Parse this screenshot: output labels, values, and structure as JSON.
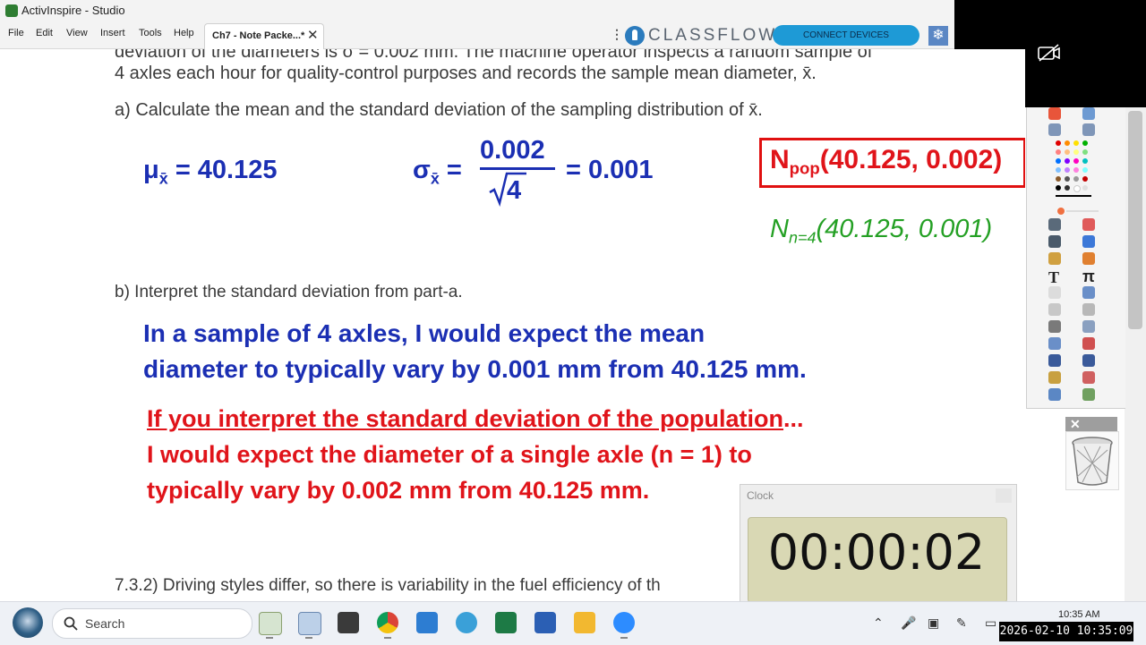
{
  "window": {
    "title": "ActivInspire - Studio"
  },
  "menu": {
    "items": [
      "File",
      "Edit",
      "View",
      "Insert",
      "Tools",
      "Help"
    ]
  },
  "doc_tab": {
    "label": "Ch7 - Note Packe...*",
    "close_icon": "close-icon"
  },
  "classflow": {
    "logo_text": "CLASSFLOW",
    "connect_label": "CONNECT DEVICES",
    "brand_color": "#1e9ad6"
  },
  "document": {
    "header_line1": "deviation of the diameters is σ = 0.002 mm. The machine operator inspects a random sample of",
    "header_line2": "4 axles each hour for quality-control purposes and records the sample mean diameter, x̄.",
    "part_a": "a) Calculate the mean and the standard deviation of the sampling distribution of x̄.",
    "mu": {
      "symbol": "μ",
      "sub": "x̄",
      "rhs": "= 40.125"
    },
    "sigma": {
      "symbol": "σ",
      "sub": "x̄",
      "eq": "=",
      "numerator": "0.002",
      "radicand": "4",
      "result": "= 0.001"
    },
    "npop": {
      "main": "N",
      "sub": "pop",
      "params": "(40.125, 0.002)"
    },
    "nsample": {
      "main": "N",
      "sub": "n=4",
      "params": "(40.125, 0.001)"
    },
    "part_b": "b) Interpret the standard deviation from part-a.",
    "answer_line1": "In a sample of 4 axles, I would expect the mean",
    "answer_line2": "diameter to typically vary by 0.001 mm from 40.125 mm.",
    "red_line1_underlined": "If you interpret the standard deviation of the population",
    "red_line1_tail": "...",
    "red_line2": "I would expect the diameter of a single axle (n = 1) to",
    "red_line3": "typically vary by 0.002 mm from 40.125 mm.",
    "next_problem": "7.3.2) Driving styles differ, so there is variability in the fuel efficiency of th"
  },
  "clock": {
    "title": "Clock",
    "time": "00:00:02"
  },
  "taskbar": {
    "search_placeholder": "Search",
    "apps": [
      "activinspire-app",
      "calculator-doc-app",
      "calculator-app",
      "chrome-app",
      "notepad-app",
      "photos-app",
      "excel-app",
      "word-app",
      "file-explorer-app",
      "zoom-app"
    ],
    "clock_time": "10:35 AM",
    "timestamp_overlay": "2026-02-10 10:35:09"
  },
  "colors": {
    "blue": "#1b2fb3",
    "red": "#e0141a",
    "green": "#24a024"
  }
}
